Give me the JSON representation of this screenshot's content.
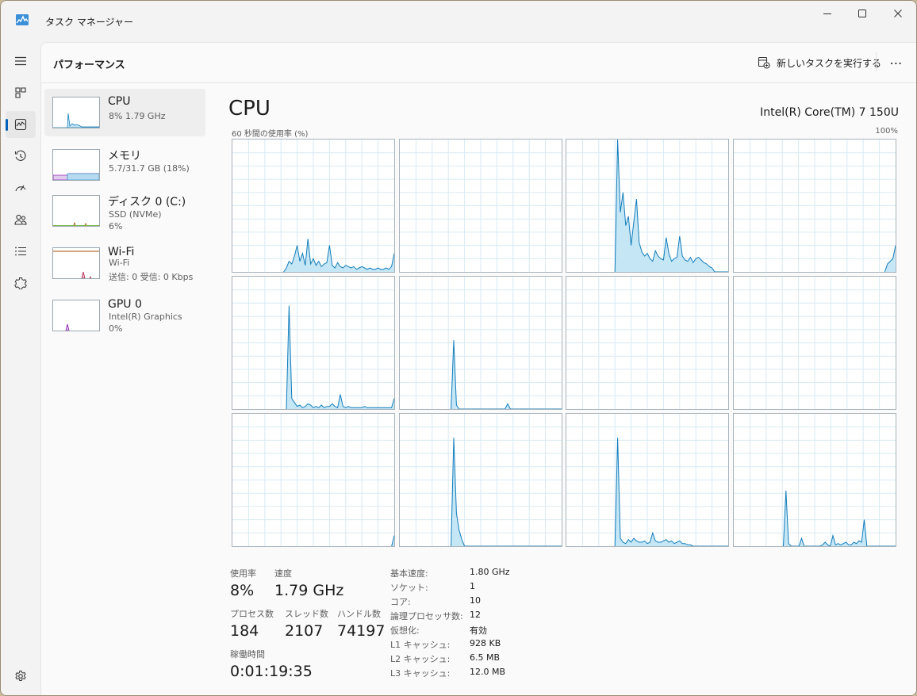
{
  "window": {
    "title": "タスク マネージャー"
  },
  "header": {
    "title": "パフォーマンス",
    "run_task": "新しいタスクを実行する",
    "more": "⋯"
  },
  "nav": [
    "menu-icon",
    "processes-icon",
    "performance-icon",
    "app-history-icon",
    "startup-apps-icon",
    "users-icon",
    "details-icon",
    "services-icon",
    "settings-icon"
  ],
  "devices": [
    {
      "name": "CPU",
      "line1": "8%  1.79 GHz",
      "line2": ""
    },
    {
      "name": "メモリ",
      "line1": "5.7/31.7 GB (18%)",
      "line2": ""
    },
    {
      "name": "ディスク 0 (C:)",
      "line1": "SSD (NVMe)",
      "line2": "6%"
    },
    {
      "name": "Wi-Fi",
      "line1": "Wi-Fi",
      "line2": "送信: 0 受信: 0 Kbps"
    },
    {
      "name": "GPU 0",
      "line1": "Intel(R) Graphics",
      "line2": "0%"
    }
  ],
  "main": {
    "title": "CPU",
    "model": "Intel(R) Core(TM) 7 150U",
    "graph_label": "60 秒間の使用率 (%)",
    "graph_max": "100%"
  },
  "stats": {
    "usage_label": "使用率",
    "usage": "8%",
    "speed_label": "速度",
    "speed": "1.79 GHz",
    "processes_label": "プロセス数",
    "processes": "184",
    "threads_label": "スレッド数",
    "threads": "2107",
    "handles_label": "ハンドル数",
    "handles": "74197",
    "uptime_label": "稼働時間",
    "uptime": "0:01:19:35"
  },
  "specs": [
    {
      "key": "基本速度:",
      "value": "1.80 GHz"
    },
    {
      "key": "ソケット:",
      "value": "1"
    },
    {
      "key": "コア:",
      "value": "10"
    },
    {
      "key": "論理プロセッサ数:",
      "value": "12"
    },
    {
      "key": "仮想化:",
      "value": "有効"
    },
    {
      "key": "L1 キャッシュ:",
      "value": "928 KB"
    },
    {
      "key": "L2 キャッシュ:",
      "value": "6.5 MB"
    },
    {
      "key": "L3 キャッシュ:",
      "value": "12.0 MB"
    }
  ],
  "colors": {
    "cpu_line": "#117dbb",
    "cpu_fill": "#c5e6f5",
    "grid": "#d9eaf4",
    "memory": "#8b12ae",
    "disk": "#4da60c",
    "wifi": "#a74f01",
    "gpu": "#8b12ae"
  },
  "chart_data": {
    "type": "area",
    "title": "60 秒間の使用率 (%)",
    "ylim": [
      0,
      100
    ],
    "x_range_seconds": [
      0,
      60
    ],
    "series": [
      {
        "values": [
          0,
          0,
          0,
          0,
          0,
          0,
          0,
          0,
          0,
          0,
          0,
          0,
          0,
          0,
          0,
          0,
          0,
          0,
          0,
          0,
          3,
          8,
          6,
          12,
          20,
          8,
          14,
          5,
          25,
          6,
          10,
          5,
          8,
          4,
          6,
          7,
          20,
          5,
          3,
          7,
          4,
          3,
          5,
          4,
          3,
          4,
          2,
          3,
          4,
          3,
          2,
          3,
          2,
          2,
          3,
          2,
          2,
          3,
          2,
          4,
          14
        ]
      },
      {
        "values": [
          0,
          0,
          0,
          0,
          0,
          0,
          0,
          0,
          0,
          0,
          0,
          0,
          0,
          0,
          0,
          0,
          0,
          0,
          0,
          0,
          0,
          0,
          0,
          0,
          0,
          0,
          0,
          0,
          0,
          0,
          0,
          0,
          0,
          0,
          0,
          0,
          0,
          0,
          0,
          0,
          0,
          0,
          0,
          0,
          0,
          0,
          0,
          0,
          0,
          0,
          0,
          0,
          0,
          0,
          0,
          0,
          0,
          0,
          0,
          0,
          0
        ]
      },
      {
        "values": [
          0,
          0,
          0,
          0,
          0,
          0,
          0,
          0,
          0,
          0,
          0,
          0,
          0,
          0,
          0,
          0,
          0,
          0,
          0,
          100,
          45,
          60,
          35,
          42,
          20,
          38,
          55,
          22,
          15,
          12,
          14,
          10,
          8,
          16,
          12,
          10,
          9,
          26,
          14,
          8,
          10,
          11,
          27,
          12,
          9,
          8,
          11,
          7,
          10,
          11,
          9,
          7,
          6,
          4,
          3,
          0,
          0,
          0,
          0,
          0,
          0
        ]
      },
      {
        "values": [
          0,
          0,
          0,
          0,
          0,
          0,
          0,
          0,
          0,
          0,
          0,
          0,
          0,
          0,
          0,
          0,
          0,
          0,
          0,
          0,
          0,
          0,
          0,
          0,
          0,
          0,
          0,
          0,
          0,
          0,
          0,
          0,
          0,
          0,
          0,
          0,
          0,
          0,
          0,
          0,
          0,
          0,
          0,
          0,
          0,
          0,
          0,
          0,
          0,
          0,
          0,
          0,
          0,
          0,
          0,
          0,
          0,
          6,
          8,
          10,
          20
        ]
      },
      {
        "values": [
          0,
          0,
          0,
          0,
          0,
          0,
          0,
          0,
          0,
          0,
          0,
          0,
          0,
          0,
          0,
          0,
          0,
          0,
          0,
          0,
          0,
          78,
          8,
          5,
          2,
          3,
          1,
          2,
          4,
          3,
          1,
          2,
          1,
          3,
          1,
          2,
          2,
          4,
          2,
          1,
          11,
          2,
          1,
          2,
          1,
          1,
          1,
          1,
          1,
          2,
          1,
          1,
          1,
          1,
          1,
          1,
          1,
          1,
          1,
          1,
          8
        ]
      },
      {
        "values": [
          0,
          0,
          0,
          0,
          0,
          0,
          0,
          0,
          0,
          0,
          0,
          0,
          0,
          0,
          0,
          0,
          0,
          0,
          0,
          0,
          52,
          3,
          0,
          0,
          0,
          0,
          0,
          0,
          0,
          0,
          0,
          0,
          0,
          0,
          0,
          0,
          0,
          0,
          0,
          0,
          4,
          0,
          0,
          0,
          0,
          0,
          0,
          0,
          0,
          0,
          0,
          0,
          0,
          0,
          0,
          0,
          0,
          0,
          0,
          0,
          0
        ]
      },
      {
        "values": [
          0,
          0,
          0,
          0,
          0,
          0,
          0,
          0,
          0,
          0,
          0,
          0,
          0,
          0,
          0,
          0,
          0,
          0,
          0,
          0,
          0,
          0,
          0,
          0,
          0,
          0,
          0,
          0,
          0,
          0,
          0,
          0,
          0,
          0,
          0,
          0,
          0,
          0,
          0,
          0,
          0,
          0,
          0,
          0,
          0,
          0,
          0,
          0,
          0,
          0,
          0,
          0,
          0,
          0,
          0,
          0,
          0,
          0,
          0,
          0,
          0
        ]
      },
      {
        "values": [
          0,
          0,
          0,
          0,
          0,
          0,
          0,
          0,
          0,
          0,
          0,
          0,
          0,
          0,
          0,
          0,
          0,
          0,
          0,
          0,
          0,
          0,
          0,
          0,
          0,
          0,
          0,
          0,
          0,
          0,
          0,
          0,
          0,
          0,
          0,
          0,
          0,
          0,
          0,
          0,
          0,
          0,
          0,
          0,
          0,
          0,
          0,
          0,
          0,
          0,
          0,
          0,
          0,
          0,
          0,
          0,
          0,
          0,
          0,
          0,
          0
        ]
      },
      {
        "values": [
          0,
          0,
          0,
          0,
          0,
          0,
          0,
          0,
          0,
          0,
          0,
          0,
          0,
          0,
          0,
          0,
          0,
          0,
          0,
          0,
          0,
          0,
          0,
          0,
          0,
          0,
          0,
          0,
          0,
          0,
          0,
          0,
          0,
          0,
          0,
          0,
          0,
          0,
          0,
          0,
          0,
          0,
          0,
          0,
          0,
          0,
          0,
          0,
          0,
          0,
          0,
          0,
          0,
          0,
          0,
          0,
          0,
          0,
          0,
          0,
          0,
          0,
          8
        ]
      },
      {
        "values": [
          0,
          0,
          0,
          0,
          0,
          0,
          0,
          0,
          0,
          0,
          0,
          0,
          0,
          0,
          0,
          0,
          0,
          0,
          0,
          0,
          82,
          25,
          12,
          5,
          0,
          0,
          0,
          0,
          0,
          0,
          0,
          0,
          0,
          0,
          0,
          0,
          0,
          0,
          0,
          0,
          0,
          0,
          0,
          0,
          0,
          0,
          0,
          0,
          0,
          0,
          0,
          0,
          0,
          0,
          0,
          0,
          0,
          0,
          0,
          0,
          0
        ]
      },
      {
        "values": [
          0,
          0,
          0,
          0,
          0,
          0,
          0,
          0,
          0,
          0,
          0,
          0,
          0,
          0,
          0,
          0,
          0,
          0,
          0,
          82,
          6,
          3,
          2,
          5,
          3,
          6,
          4,
          3,
          3,
          4,
          2,
          3,
          10,
          4,
          3,
          3,
          4,
          5,
          3,
          4,
          2,
          3,
          4,
          2,
          2,
          1,
          1,
          0,
          0,
          0,
          0,
          0,
          0,
          0,
          0,
          0,
          0,
          0,
          0,
          0,
          0
        ]
      },
      {
        "values": [
          0,
          0,
          0,
          0,
          0,
          0,
          0,
          0,
          0,
          0,
          0,
          0,
          0,
          0,
          0,
          0,
          0,
          0,
          0,
          0,
          42,
          2,
          0,
          0,
          0,
          0,
          6,
          0,
          0,
          0,
          0,
          0,
          0,
          0,
          1,
          3,
          1,
          0,
          8,
          1,
          2,
          1,
          2,
          3,
          1,
          1,
          3,
          2,
          4,
          3,
          20,
          0,
          0,
          0,
          0,
          0,
          0,
          0,
          0,
          0,
          0,
          0,
          0
        ]
      }
    ]
  }
}
